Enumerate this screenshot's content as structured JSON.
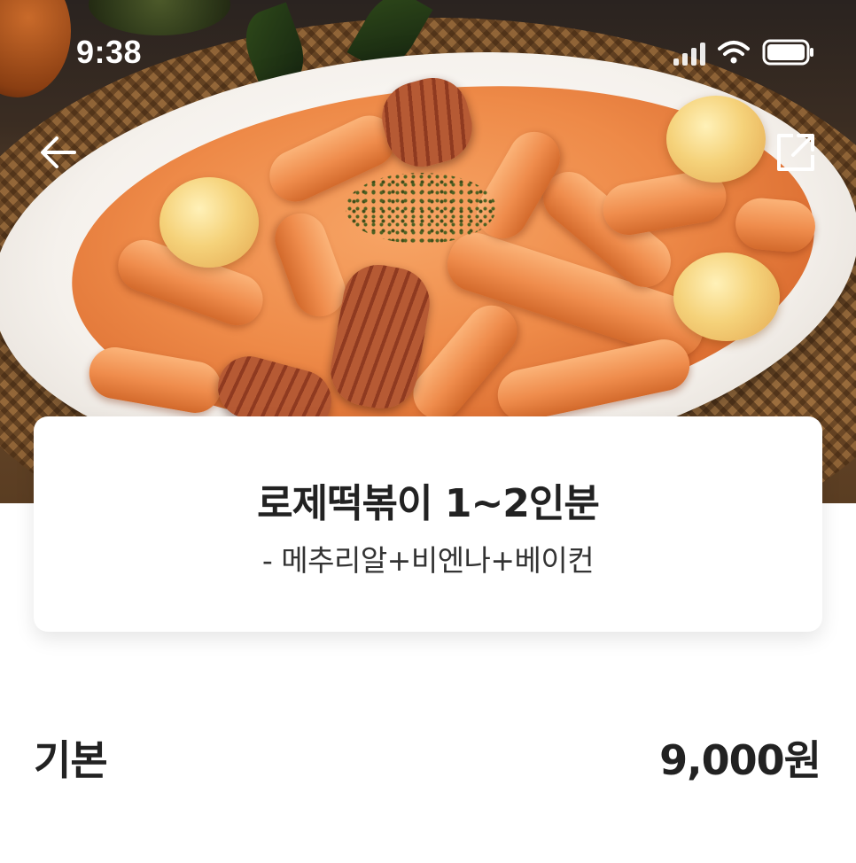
{
  "status_bar": {
    "time": "9:38",
    "icons": [
      "signal-icon",
      "wifi-icon",
      "battery-icon"
    ]
  },
  "nav": {
    "back_icon": "arrow-left-icon",
    "share_icon": "share-external-icon"
  },
  "hero_image": {
    "subject": "rose tteokbokki in a white oval dish"
  },
  "menu": {
    "title": "로제떡볶이 1~2인분",
    "description": "- 메추리알+비엔나+베이컨"
  },
  "price": {
    "label": "기본",
    "value": "9,000원"
  },
  "colors": {
    "text_primary": "#222222",
    "card_background": "#ffffff",
    "status_text": "#ffffff"
  }
}
